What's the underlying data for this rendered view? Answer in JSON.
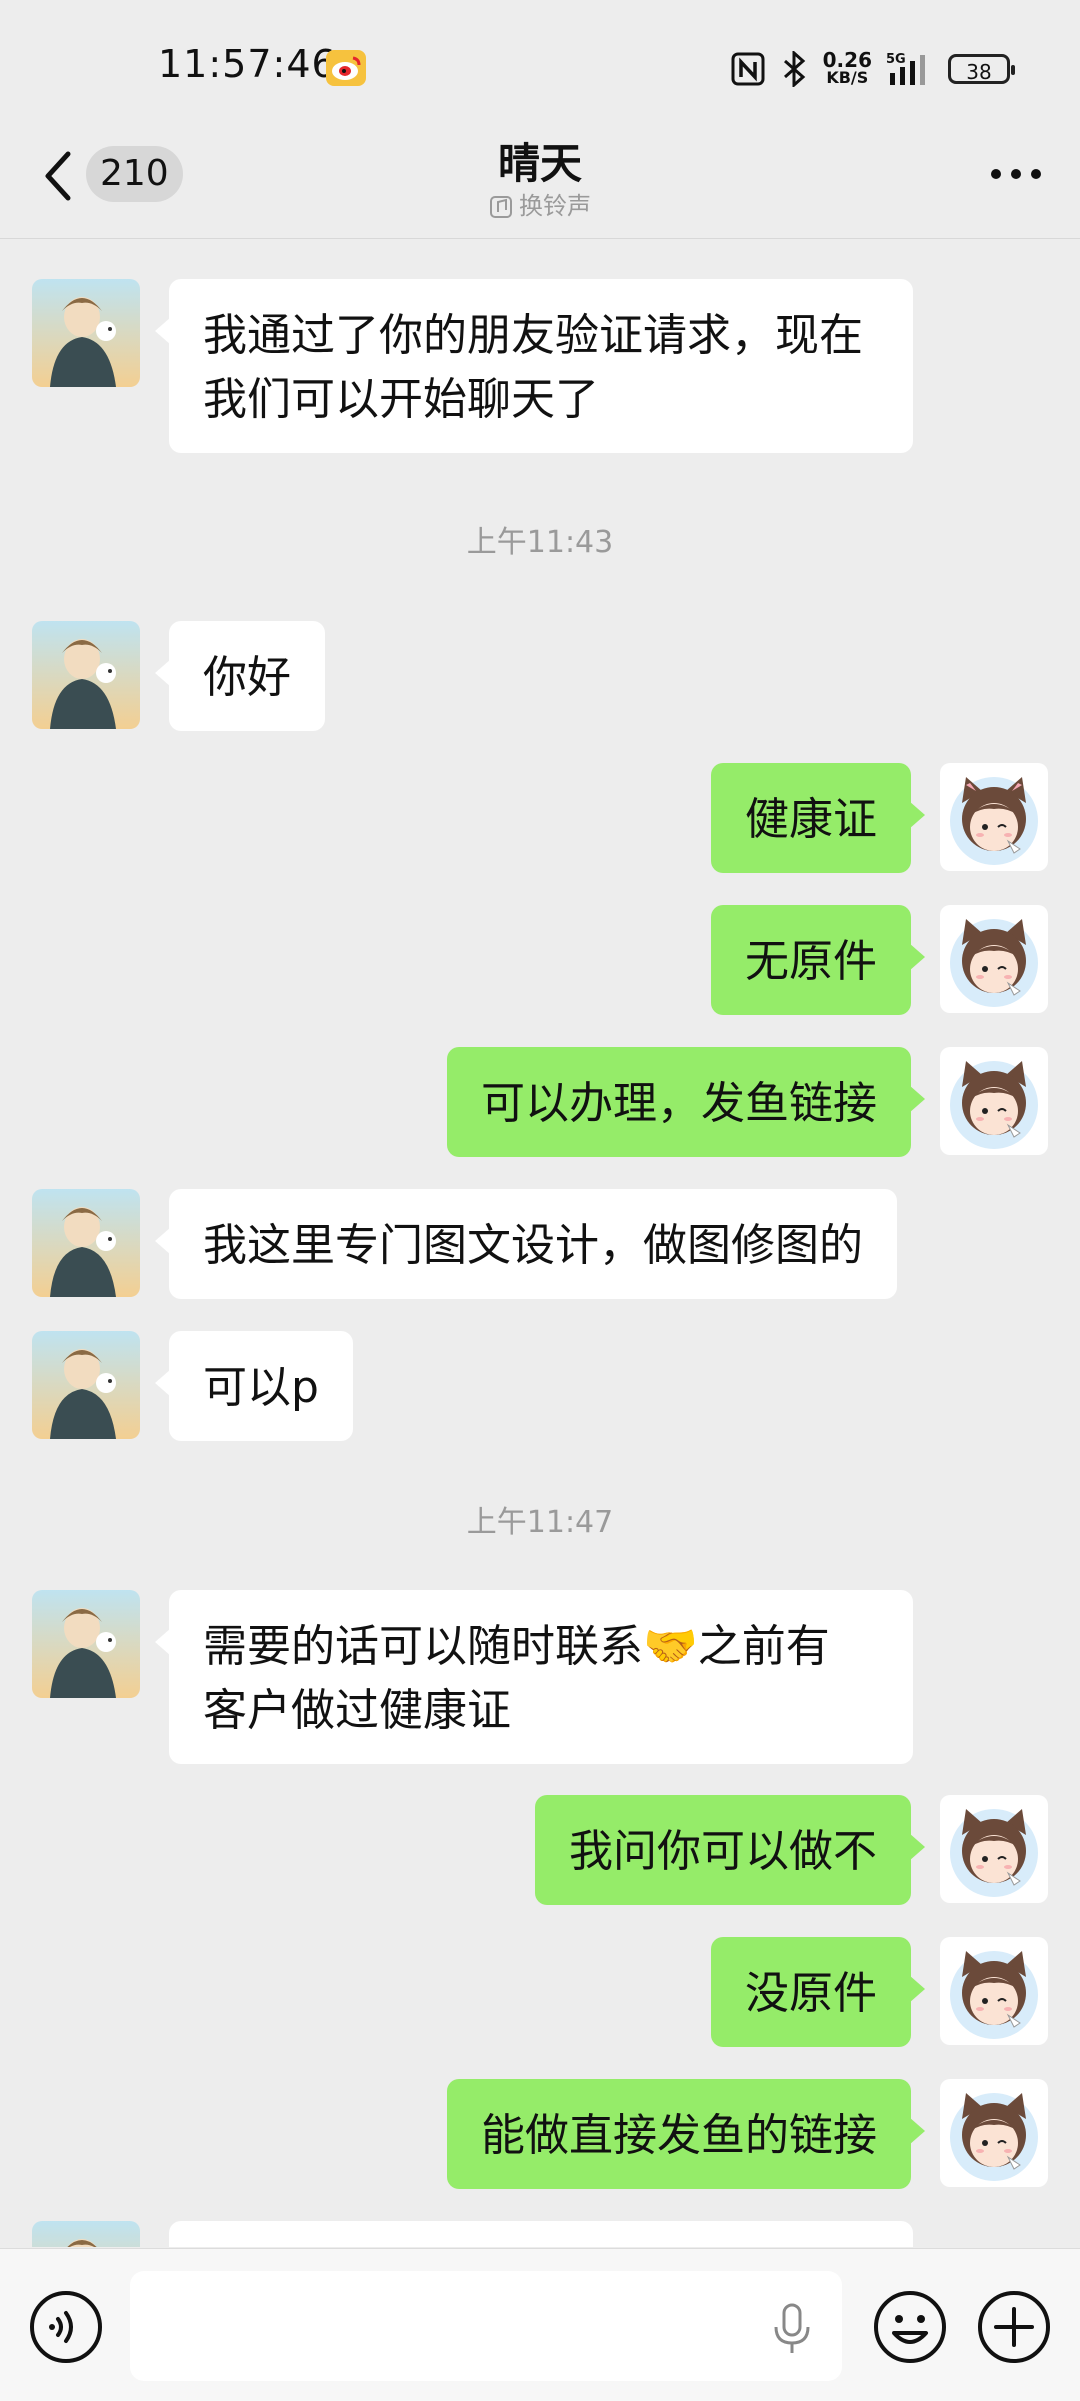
{
  "status_bar": {
    "time": "11:57:46",
    "net_speed_value": "0.26",
    "net_speed_unit": "KB/S",
    "network": "5G",
    "battery": "38"
  },
  "header": {
    "unread_count": "210",
    "title": "晴天",
    "subtitle": "换铃声"
  },
  "messages": [
    {
      "side": "other",
      "text": "我通过了你的朋友验证请求，现在\n我们可以开始聊天了"
    },
    {
      "timestamp": "上午11:43"
    },
    {
      "side": "other",
      "text": "你好"
    },
    {
      "side": "self",
      "text": "健康证"
    },
    {
      "side": "self",
      "text": "无原件"
    },
    {
      "side": "self",
      "text": "可以办理，发鱼链接"
    },
    {
      "side": "other",
      "text": "我这里专门图文设计，做图修图的"
    },
    {
      "side": "other",
      "text": "可以p"
    },
    {
      "timestamp": "上午11:47"
    },
    {
      "side": "other",
      "text": "需要的话可以随时联系🤝之前有\n客户做过健康证"
    },
    {
      "side": "self",
      "text": "我问你可以做不"
    },
    {
      "side": "self",
      "text": "没原件"
    },
    {
      "side": "self",
      "text": "能做直接发鱼的链接"
    }
  ],
  "input": {
    "value": ""
  },
  "colors": {
    "self_bubble": "#95ec69",
    "other_bubble": "#ffffff",
    "background": "#ededed"
  }
}
